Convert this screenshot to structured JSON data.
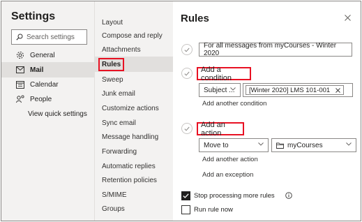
{
  "settings": {
    "title": "Settings",
    "search_placeholder": "Search settings",
    "nav": [
      {
        "label": "General",
        "icon": "gear-icon"
      },
      {
        "label": "Mail",
        "icon": "mail-icon"
      },
      {
        "label": "Calendar",
        "icon": "calendar-icon"
      },
      {
        "label": "People",
        "icon": "people-icon"
      }
    ],
    "selected_nav": "Mail",
    "view_quick_settings": "View quick settings"
  },
  "mail_menu": {
    "items": [
      "Layout",
      "Compose and reply",
      "Attachments",
      "Rules",
      "Sweep",
      "Junk email",
      "Customize actions",
      "Sync email",
      "Message handling",
      "Forwarding",
      "Automatic replies",
      "Retention policies",
      "S/MIME",
      "Groups"
    ],
    "selected": "Rules"
  },
  "rules": {
    "title": "Rules",
    "rule_name": "For all messages from myCourses - Winter 2020",
    "add_condition": "Add a condition",
    "condition_field": "Subject ...",
    "condition_value": "[Winter 2020] LMS 101-001",
    "add_another_condition": "Add another condition",
    "add_action": "Add an action",
    "action_field": "Move to",
    "action_folder": "myCourses",
    "add_another_action": "Add another action",
    "add_exception": "Add an exception",
    "stop_processing_label": "Stop processing more rules",
    "stop_processing_checked": true,
    "run_rule_now_label": "Run rule now",
    "run_rule_now_checked": false
  },
  "colors": {
    "highlight_border": "#e81123",
    "panel_background": "#f3f2f1",
    "selected_background": "#e1dfdd"
  }
}
